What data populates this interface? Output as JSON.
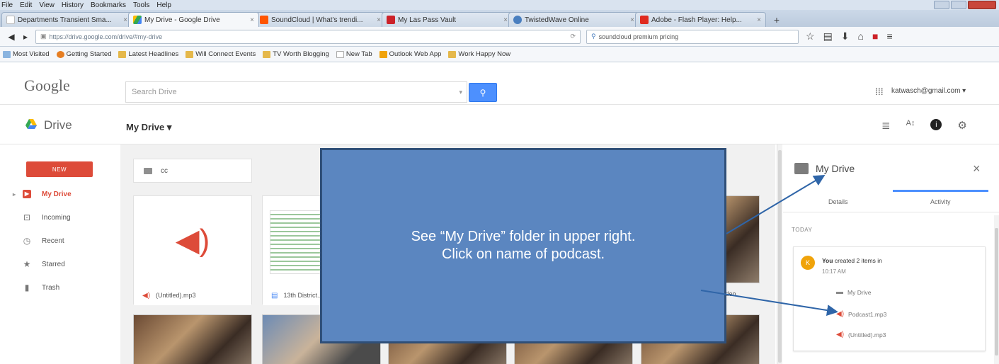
{
  "browser": {
    "menu": [
      "File",
      "Edit",
      "View",
      "History",
      "Bookmarks",
      "Tools",
      "Help"
    ],
    "tabs": [
      {
        "label": "Departments Transient Sma...",
        "color": "#ffffff"
      },
      {
        "label": "My Drive - Google Drive",
        "color": "#34a853",
        "active": true
      },
      {
        "label": "SoundCloud | What's trendi...",
        "color": "#ff5500"
      },
      {
        "label": "My Las Pass Vault",
        "color": "#cc2229"
      },
      {
        "label": "TwistedWave Online",
        "color": "#4a7fbf"
      },
      {
        "label": "Adobe - Flash Player: Help...",
        "color": "#e02b20"
      }
    ],
    "url": "https://drive.google.com/drive/#my-drive",
    "search_value": "soundcloud premium pricing",
    "bookmarks": [
      "Most Visited",
      "Getting Started",
      "Latest Headlines",
      "Will Connect Events",
      "TV Worth Blogging",
      "New Tab",
      "Outlook Web App",
      "Work Happy Now"
    ]
  },
  "google": {
    "logo": "Google",
    "search_placeholder": "Search Drive",
    "account": "katwasch@gmail.com"
  },
  "drive": {
    "app_label": "Drive",
    "title": "My Drive",
    "new_button": "NEW",
    "nav": [
      {
        "label": "My Drive",
        "icon": "▶",
        "active": true
      },
      {
        "label": "Incoming",
        "icon": "⊡"
      },
      {
        "label": "Recent",
        "icon": "◷"
      },
      {
        "label": "Starred",
        "icon": "★"
      },
      {
        "label": "Trash",
        "icon": "▮"
      }
    ],
    "folder": "cc",
    "files": [
      {
        "name": "(Untitled).mp3",
        "kind": "audio"
      },
      {
        "name": "13th District...",
        "kind": "doc"
      },
      {
        "name": "photo",
        "kind": "photo"
      }
    ],
    "partial_label": "...ideo"
  },
  "details": {
    "title": "My Drive",
    "tab_details": "Details",
    "tab_activity": "Activity",
    "section": "TODAY",
    "activity_user_initial": "K",
    "activity_text_bold": "You",
    "activity_text": "created 2 items in",
    "activity_time": "10:17 AM",
    "activity_rows": [
      {
        "label": "My Drive",
        "icon": "folder"
      },
      {
        "label": "Podcast1.mp3",
        "icon": "audio"
      },
      {
        "label": "(Untitled).mp3",
        "icon": "audio"
      }
    ]
  },
  "annotation": {
    "line1": "See “My Drive” folder in upper right.",
    "line2": "Click on name of podcast."
  },
  "colors": {
    "accent_red": "#dd4b39",
    "overlay_blue": "#5b86c0",
    "search_blue": "#4d90fe"
  }
}
